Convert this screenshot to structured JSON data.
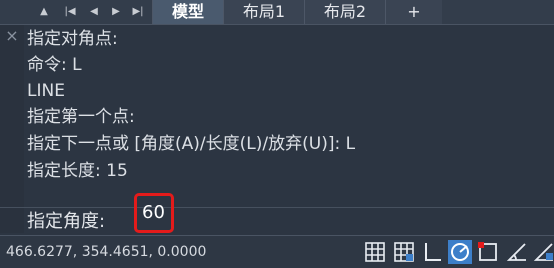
{
  "tabs": [
    {
      "label": "模型",
      "active": true
    },
    {
      "label": "布局1",
      "active": false
    },
    {
      "label": "布局2",
      "active": false
    },
    {
      "label": "+",
      "active": false
    }
  ],
  "nav": {
    "first": "▲",
    "prev_start": "|◀",
    "prev": "◀",
    "next": "▶",
    "next_end": "▶|"
  },
  "history": [
    "指定对角点:",
    "命令: L",
    "LINE",
    "指定第一个点:",
    "指定下一点或 [角度(A)/长度(L)/放弃(U)]: L",
    "指定长度: 15"
  ],
  "command": {
    "prompt": "指定角度:",
    "value": "60"
  },
  "close_icon": "×",
  "status": {
    "coords": "466.6277, 354.4651, 0.0000"
  },
  "status_icons": [
    "grid-icon",
    "snap-grid-icon",
    "ortho-icon",
    "polar-icon",
    "object-snap-icon",
    "angle-icon",
    "angle-track-icon"
  ],
  "colors": {
    "background": "#2c3542",
    "highlight": "#e41b1b",
    "active_toggle": "#3d7fc9"
  }
}
